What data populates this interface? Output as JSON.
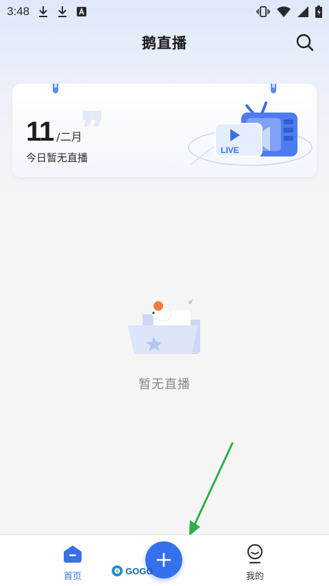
{
  "status_bar": {
    "time": "3:48"
  },
  "header": {
    "title": "鹅直播"
  },
  "date_card": {
    "day": "11",
    "separator": "/",
    "month": "二月",
    "status": "今日暂无直播",
    "badge_text": "LIVE"
  },
  "empty_state": {
    "message": "暂无直播"
  },
  "tab_bar": {
    "home_label": "首页",
    "mine_label": "我的"
  },
  "watermark": {
    "text": "GOGO"
  },
  "colors": {
    "accent": "#3570ef",
    "arrow": "#2fae4b"
  }
}
